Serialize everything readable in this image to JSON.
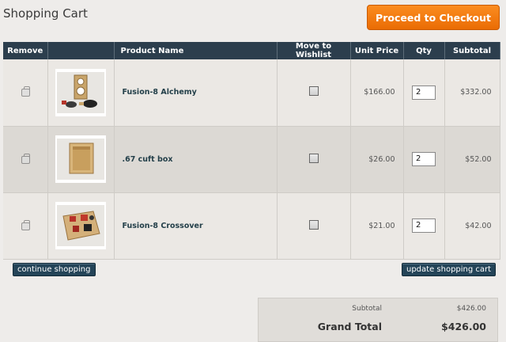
{
  "page": {
    "title": "Shopping Cart",
    "checkout_label": "Proceed to Checkout"
  },
  "table": {
    "headers": {
      "remove": "Remove",
      "image": "",
      "product": "Product Name",
      "wishlist": "Move to Wishlist",
      "price": "Unit Price",
      "qty": "Qty",
      "subtotal": "Subtotal"
    },
    "rows": [
      {
        "name": "Fusion-8 Alchemy",
        "price": "$166.00",
        "qty": "2",
        "subtotal": "$332.00",
        "thumb_icon": "speaker-kit-image"
      },
      {
        "name": ".67 cuft box",
        "price": "$26.00",
        "qty": "2",
        "subtotal": "$52.00",
        "thumb_icon": "wooden-box-image"
      },
      {
        "name": "Fusion-8 Crossover",
        "price": "$21.00",
        "qty": "2",
        "subtotal": "$42.00",
        "thumb_icon": "crossover-board-image"
      }
    ]
  },
  "actions": {
    "continue_label": "continue shopping",
    "update_label": "update shopping cart"
  },
  "totals": {
    "subtotal_label": "Subtotal",
    "subtotal_value": "$426.00",
    "grand_label": "Grand Total",
    "grand_value": "$426.00"
  },
  "colors": {
    "header_bg": "#2c3e4d",
    "checkout_orange": "#f57c12",
    "button_dark": "#244458",
    "product_link": "#24404a"
  }
}
